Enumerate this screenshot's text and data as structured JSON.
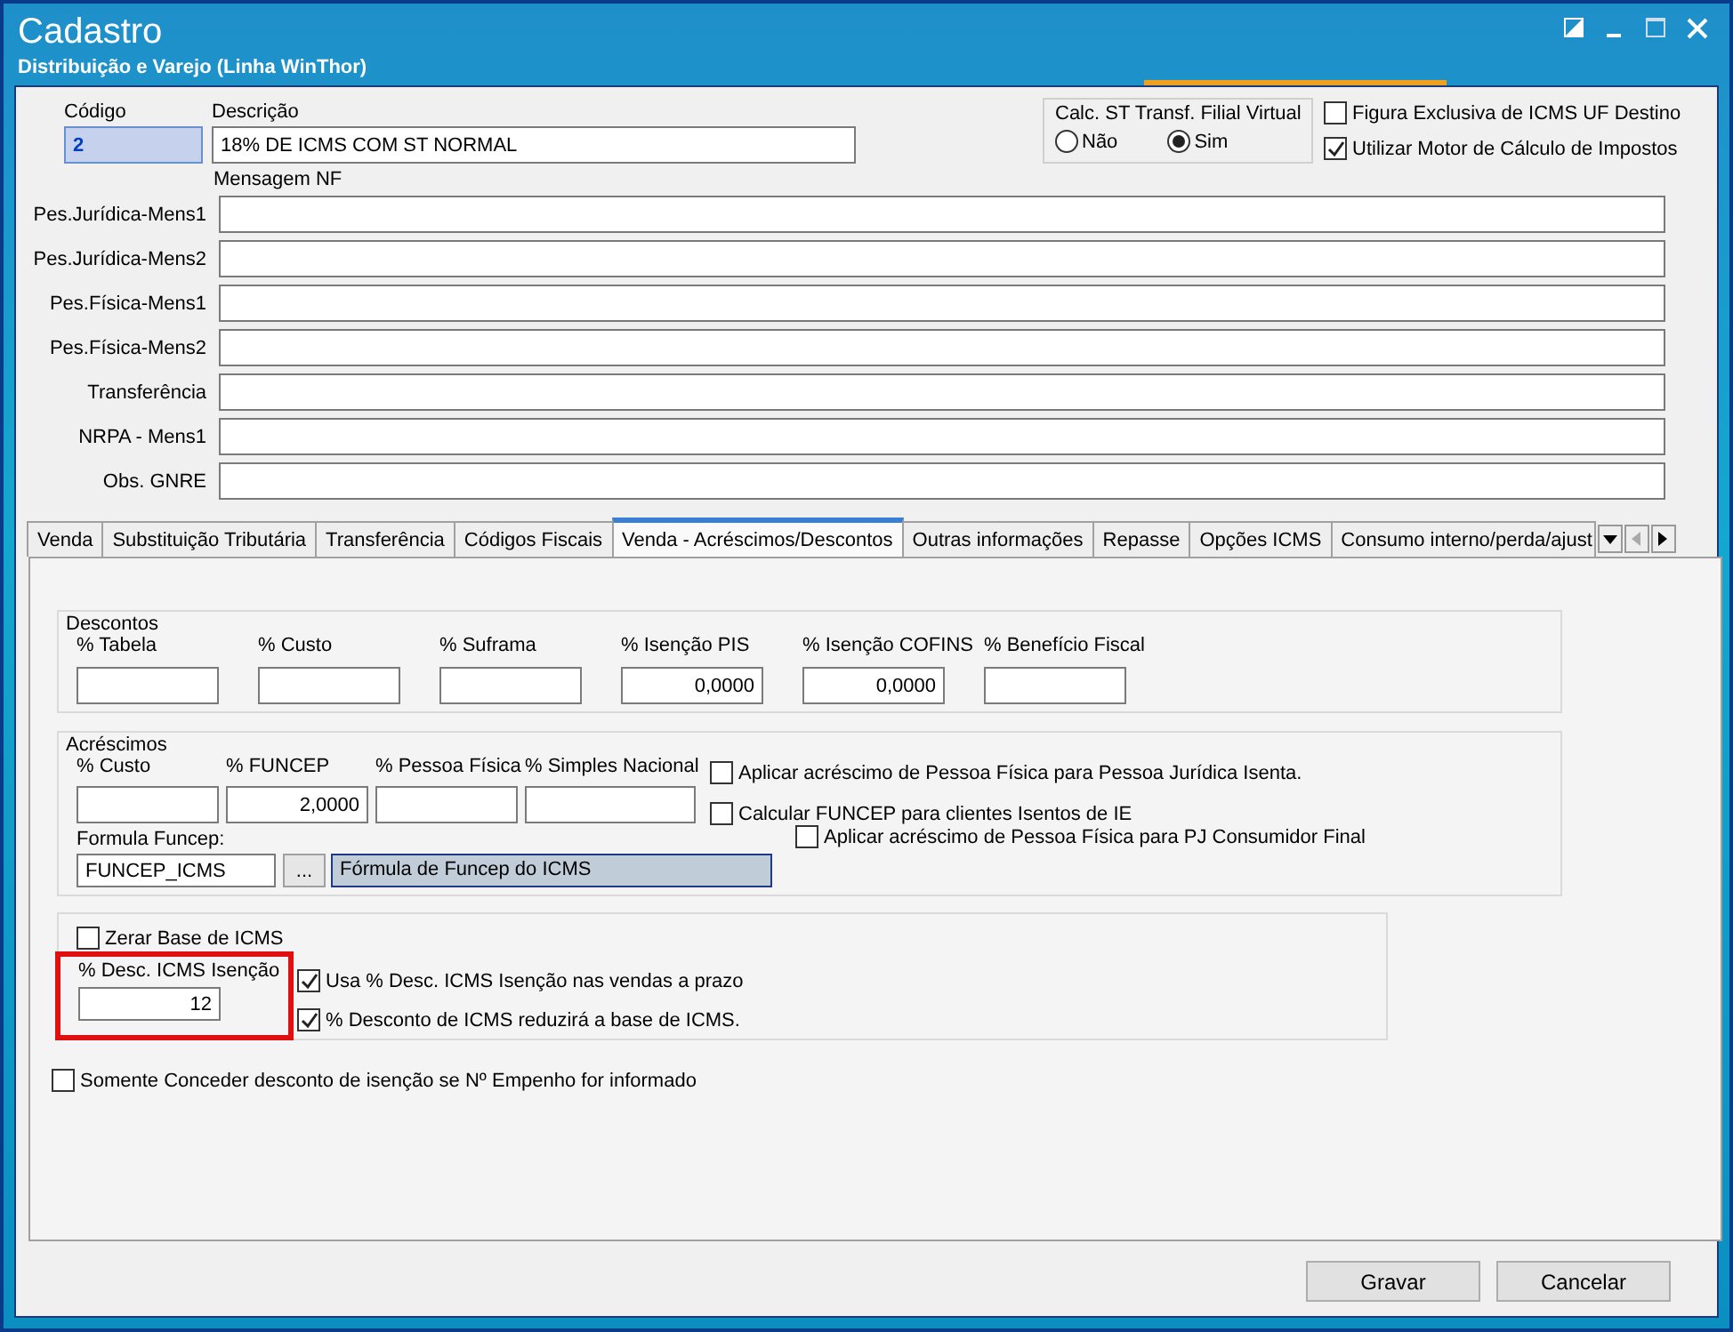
{
  "window": {
    "title": "Cadastro",
    "subtitle": "Distribuição e Varejo (Linha WinThor)"
  },
  "header": {
    "codigo": {
      "label": "Código",
      "value": "2"
    },
    "descricao": {
      "label": "Descrição",
      "value": "18% DE ICMS COM ST NORMAL"
    },
    "calc_st": {
      "label": "Calc. ST Transf. Filial Virtual",
      "options": [
        {
          "label": "Não",
          "selected": false
        },
        {
          "label": "Sim",
          "selected": true
        }
      ]
    },
    "checkboxes": [
      {
        "label": "Figura Exclusiva de ICMS UF Destino",
        "checked": false
      },
      {
        "label": "Utilizar Motor de Cálculo de Impostos",
        "checked": true
      }
    ]
  },
  "mensagem_nf": {
    "label": "Mensagem NF",
    "rows": [
      {
        "label": "Pes.Jurídica-Mens1"
      },
      {
        "label": "Pes.Jurídica-Mens2"
      },
      {
        "label": "Pes.Física-Mens1"
      },
      {
        "label": "Pes.Física-Mens2"
      },
      {
        "label": "Transferência"
      },
      {
        "label": "NRPA - Mens1"
      },
      {
        "label": "Obs. GNRE"
      }
    ]
  },
  "tabs": [
    {
      "label": "Venda",
      "selected": false
    },
    {
      "label": "Substituição Tributária",
      "selected": false
    },
    {
      "label": "Transferência",
      "selected": false
    },
    {
      "label": "Códigos Fiscais",
      "selected": false
    },
    {
      "label": "Venda - Acréscimos/Descontos",
      "selected": true
    },
    {
      "label": "Outras informações",
      "selected": false
    },
    {
      "label": "Repasse",
      "selected": false
    },
    {
      "label": "Opções ICMS",
      "selected": false
    },
    {
      "label": "Consumo interno/perda/ajust",
      "selected": false
    }
  ],
  "descontos": {
    "title": "Descontos",
    "fields": [
      {
        "label": "% Tabela"
      },
      {
        "label": "% Custo"
      },
      {
        "label": "% Suframa"
      },
      {
        "label": "% Isenção PIS",
        "value": "0,0000"
      },
      {
        "label": "% Isenção COFINS",
        "value": "0,0000"
      },
      {
        "label": "% Benefício Fiscal"
      }
    ]
  },
  "acrescimos": {
    "title": "Acréscimos",
    "fields": [
      {
        "label": "% Custo"
      },
      {
        "label": "% FUNCEP",
        "value": "2,0000"
      },
      {
        "label": "% Pessoa Física"
      },
      {
        "label": "% Simples Nacional"
      }
    ],
    "checkboxes": [
      {
        "label": "Aplicar acréscimo de Pessoa Física para Pessoa Jurídica Isenta.",
        "checked": false
      },
      {
        "label": "Calcular FUNCEP para clientes Isentos de IE",
        "checked": false
      },
      {
        "label": "Aplicar acréscimo de Pessoa Física para PJ Consumidor Final",
        "checked": false
      }
    ],
    "formula": {
      "label": "Formula Funcep:",
      "value": "FUNCEP_ICMS",
      "button": "...",
      "description": "Fórmula de Funcep do ICMS"
    }
  },
  "isencao": {
    "zerar": {
      "label": "Zerar Base de ICMS",
      "checked": false
    },
    "field": {
      "label": "% Desc. ICMS Isenção",
      "value": "12",
      "highlighted": true
    },
    "checkboxes": [
      {
        "label": "Usa % Desc. ICMS Isenção nas vendas a prazo",
        "checked": true
      },
      {
        "label": "% Desconto de ICMS reduzirá a base de ICMS.",
        "checked": true
      }
    ]
  },
  "somente": {
    "label": "Somente Conceder desconto de isenção se Nº Empenho for informado",
    "checked": false
  },
  "buttons": [
    "Gravar",
    "Cancelar"
  ]
}
